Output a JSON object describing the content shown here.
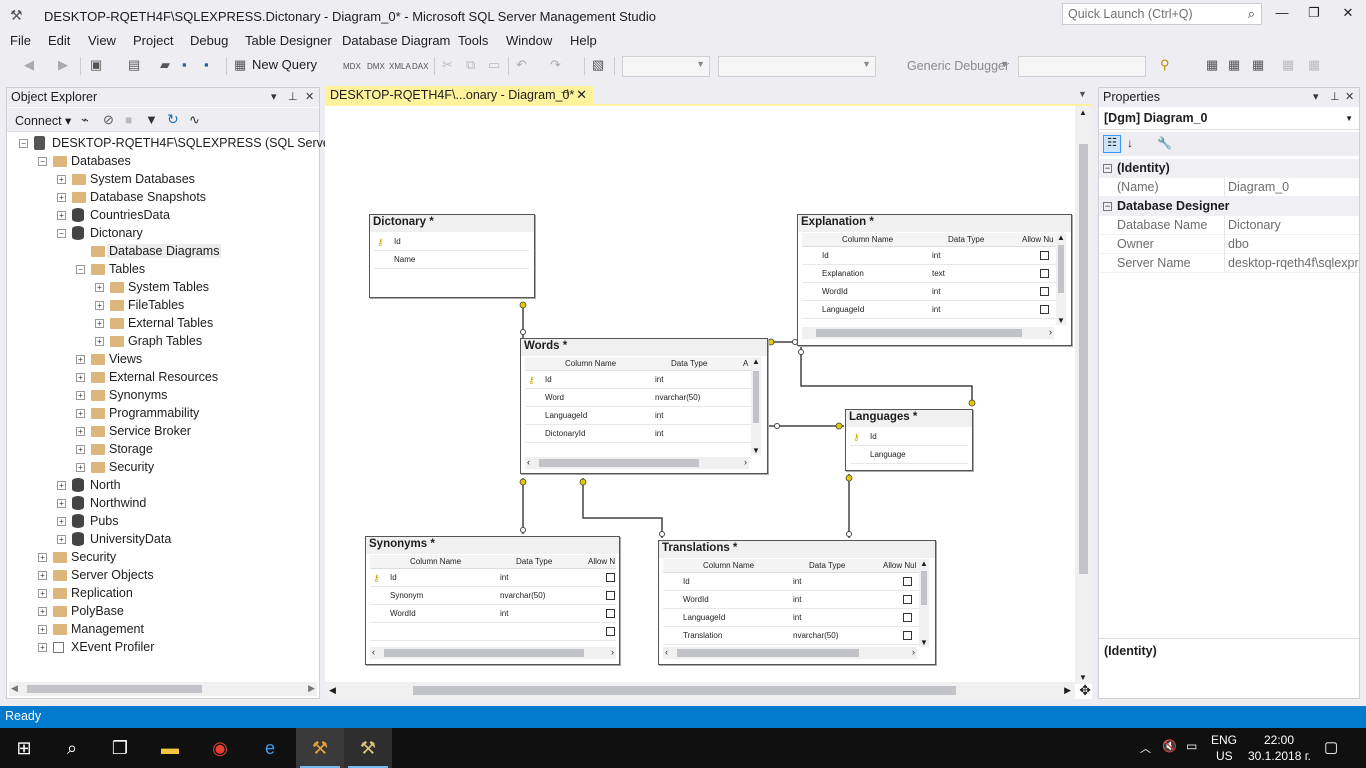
{
  "window": {
    "title": "DESKTOP-RQETH4F\\SQLEXPRESS.Dictonary - Diagram_0* - Microsoft SQL Server Management Studio",
    "quick_launch_placeholder": "Quick Launch (Ctrl+Q)"
  },
  "menu": [
    "File",
    "Edit",
    "View",
    "Project",
    "Debug",
    "Table Designer",
    "Database Diagram",
    "Tools",
    "Window",
    "Help"
  ],
  "toolbar": {
    "new_query": "New Query",
    "mdx": "MDX",
    "dmx": "DMX",
    "xmla": "XMLA",
    "dax": "DAX",
    "debugger": "Generic Debugger"
  },
  "object_explorer": {
    "title": "Object Explorer",
    "connect": "Connect",
    "nodes": [
      {
        "label": "DESKTOP-RQETH4F\\SQLEXPRESS (SQL Server 14.0.",
        "level": 0,
        "icon": "server-icon",
        "expanded": true
      },
      {
        "label": "Databases",
        "level": 1,
        "icon": "folder-icon",
        "expanded": true
      },
      {
        "label": "System Databases",
        "level": 2,
        "icon": "folder-icon",
        "expanded": false
      },
      {
        "label": "Database Snapshots",
        "level": 2,
        "icon": "folder-icon",
        "expanded": false
      },
      {
        "label": "CountriesData",
        "level": 2,
        "icon": "database-icon",
        "expanded": false
      },
      {
        "label": "Dictonary",
        "level": 2,
        "icon": "database-icon",
        "expanded": true
      },
      {
        "label": "Database Diagrams",
        "level": 3,
        "icon": "folder-icon",
        "expanded": null,
        "selected": true
      },
      {
        "label": "Tables",
        "level": 3,
        "icon": "folder-icon",
        "expanded": true
      },
      {
        "label": "System Tables",
        "level": 4,
        "icon": "folder-icon",
        "expanded": false
      },
      {
        "label": "FileTables",
        "level": 4,
        "icon": "folder-icon",
        "expanded": false
      },
      {
        "label": "External Tables",
        "level": 4,
        "icon": "folder-icon",
        "expanded": false
      },
      {
        "label": "Graph Tables",
        "level": 4,
        "icon": "folder-icon",
        "expanded": false
      },
      {
        "label": "Views",
        "level": 3,
        "icon": "folder-icon",
        "expanded": false
      },
      {
        "label": "External Resources",
        "level": 3,
        "icon": "folder-icon",
        "expanded": false
      },
      {
        "label": "Synonyms",
        "level": 3,
        "icon": "folder-icon",
        "expanded": false
      },
      {
        "label": "Programmability",
        "level": 3,
        "icon": "folder-icon",
        "expanded": false
      },
      {
        "label": "Service Broker",
        "level": 3,
        "icon": "folder-icon",
        "expanded": false
      },
      {
        "label": "Storage",
        "level": 3,
        "icon": "folder-icon",
        "expanded": false
      },
      {
        "label": "Security",
        "level": 3,
        "icon": "folder-icon",
        "expanded": false
      },
      {
        "label": "North",
        "level": 2,
        "icon": "database-icon",
        "expanded": false
      },
      {
        "label": "Northwind",
        "level": 2,
        "icon": "database-icon",
        "expanded": false
      },
      {
        "label": "Pubs",
        "level": 2,
        "icon": "database-icon",
        "expanded": false
      },
      {
        "label": "UniversityData",
        "level": 2,
        "icon": "database-icon",
        "expanded": false
      },
      {
        "label": "Security",
        "level": 1,
        "icon": "folder-icon",
        "expanded": false
      },
      {
        "label": "Server Objects",
        "level": 1,
        "icon": "folder-icon",
        "expanded": false
      },
      {
        "label": "Replication",
        "level": 1,
        "icon": "folder-icon",
        "expanded": false
      },
      {
        "label": "PolyBase",
        "level": 1,
        "icon": "folder-icon",
        "expanded": false
      },
      {
        "label": "Management",
        "level": 1,
        "icon": "folder-icon",
        "expanded": false
      },
      {
        "label": "XEvent Profiler",
        "level": 1,
        "icon": "profiler-icon",
        "expanded": false
      }
    ]
  },
  "document_tab": {
    "label": "DESKTOP-RQETH4F\\...onary - Diagram_0*"
  },
  "diagram": {
    "headers": {
      "column_name": "Column Name",
      "data_type": "Data Type",
      "allow_nulls": "Allow Nu",
      "allow_nulls_short": "Allow N",
      "a": "A",
      "allow_nulls_tr": "Allow Nul"
    },
    "dictonary": {
      "title": "Dictonary *",
      "columns": [
        "Id",
        "Name"
      ]
    },
    "explanation": {
      "title": "Explanation *",
      "rows": [
        [
          "Id",
          "int"
        ],
        [
          "Explanation",
          "text"
        ],
        [
          "WordId",
          "int"
        ],
        [
          "LanguageId",
          "int"
        ]
      ]
    },
    "words": {
      "title": "Words *",
      "rows": [
        [
          "Id",
          "int"
        ],
        [
          "Word",
          "nvarchar(50)"
        ],
        [
          "LanguageId",
          "int"
        ],
        [
          "DictonaryId",
          "int"
        ]
      ]
    },
    "languages": {
      "title": "Languages *",
      "columns": [
        "Id",
        "Language"
      ]
    },
    "synonyms": {
      "title": "Synonyms *",
      "rows": [
        [
          "Id",
          "int"
        ],
        [
          "Synonym",
          "nvarchar(50)"
        ],
        [
          "WordId",
          "int"
        ],
        [
          "",
          ""
        ]
      ]
    },
    "translations": {
      "title": "Translations *",
      "rows": [
        [
          "Id",
          "int"
        ],
        [
          "WordId",
          "int"
        ],
        [
          "LanguageId",
          "int"
        ],
        [
          "Translation",
          "nvarchar(50)"
        ]
      ]
    }
  },
  "properties": {
    "title": "Properties",
    "object": "[Dgm] Diagram_0",
    "categories": [
      {
        "name": "(Identity)",
        "rows": [
          {
            "k": "(Name)",
            "v": "Diagram_0"
          }
        ]
      },
      {
        "name": "Database Designer",
        "rows": [
          {
            "k": "Database Name",
            "v": "Dictonary"
          },
          {
            "k": "Owner",
            "v": "dbo"
          },
          {
            "k": "Server Name",
            "v": "desktop-rqeth4f\\sqlexpre"
          }
        ]
      }
    ],
    "description": "(Identity)"
  },
  "status": "Ready",
  "taskbar": {
    "lang1": "ENG",
    "lang2": "US",
    "time": "22:00",
    "date": "30.1.2018 г."
  },
  "colors": {
    "accent": "#007acc",
    "tab_active": "#fff29d",
    "folder": "#dcb67a",
    "taskbar": "#101010"
  }
}
